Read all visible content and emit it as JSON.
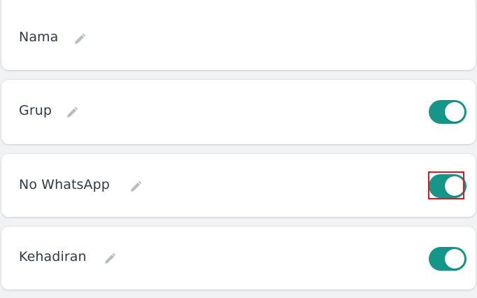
{
  "colors": {
    "toggle_on": "#169689",
    "edit_icon": "#b7bcc3",
    "label_text": "#2f3a48",
    "highlight": "#e0141e"
  },
  "fields": [
    {
      "label": "Nama",
      "icon": "pencil-icon",
      "has_toggle": false
    },
    {
      "label": "Grup",
      "icon": "pencil-icon",
      "has_toggle": true,
      "toggle_on": true
    },
    {
      "label": "No WhatsApp",
      "icon": "pencil-icon",
      "has_toggle": true,
      "toggle_on": true,
      "highlighted": true
    },
    {
      "label": "Kehadiran",
      "icon": "pencil-icon",
      "has_toggle": true,
      "toggle_on": true
    }
  ]
}
